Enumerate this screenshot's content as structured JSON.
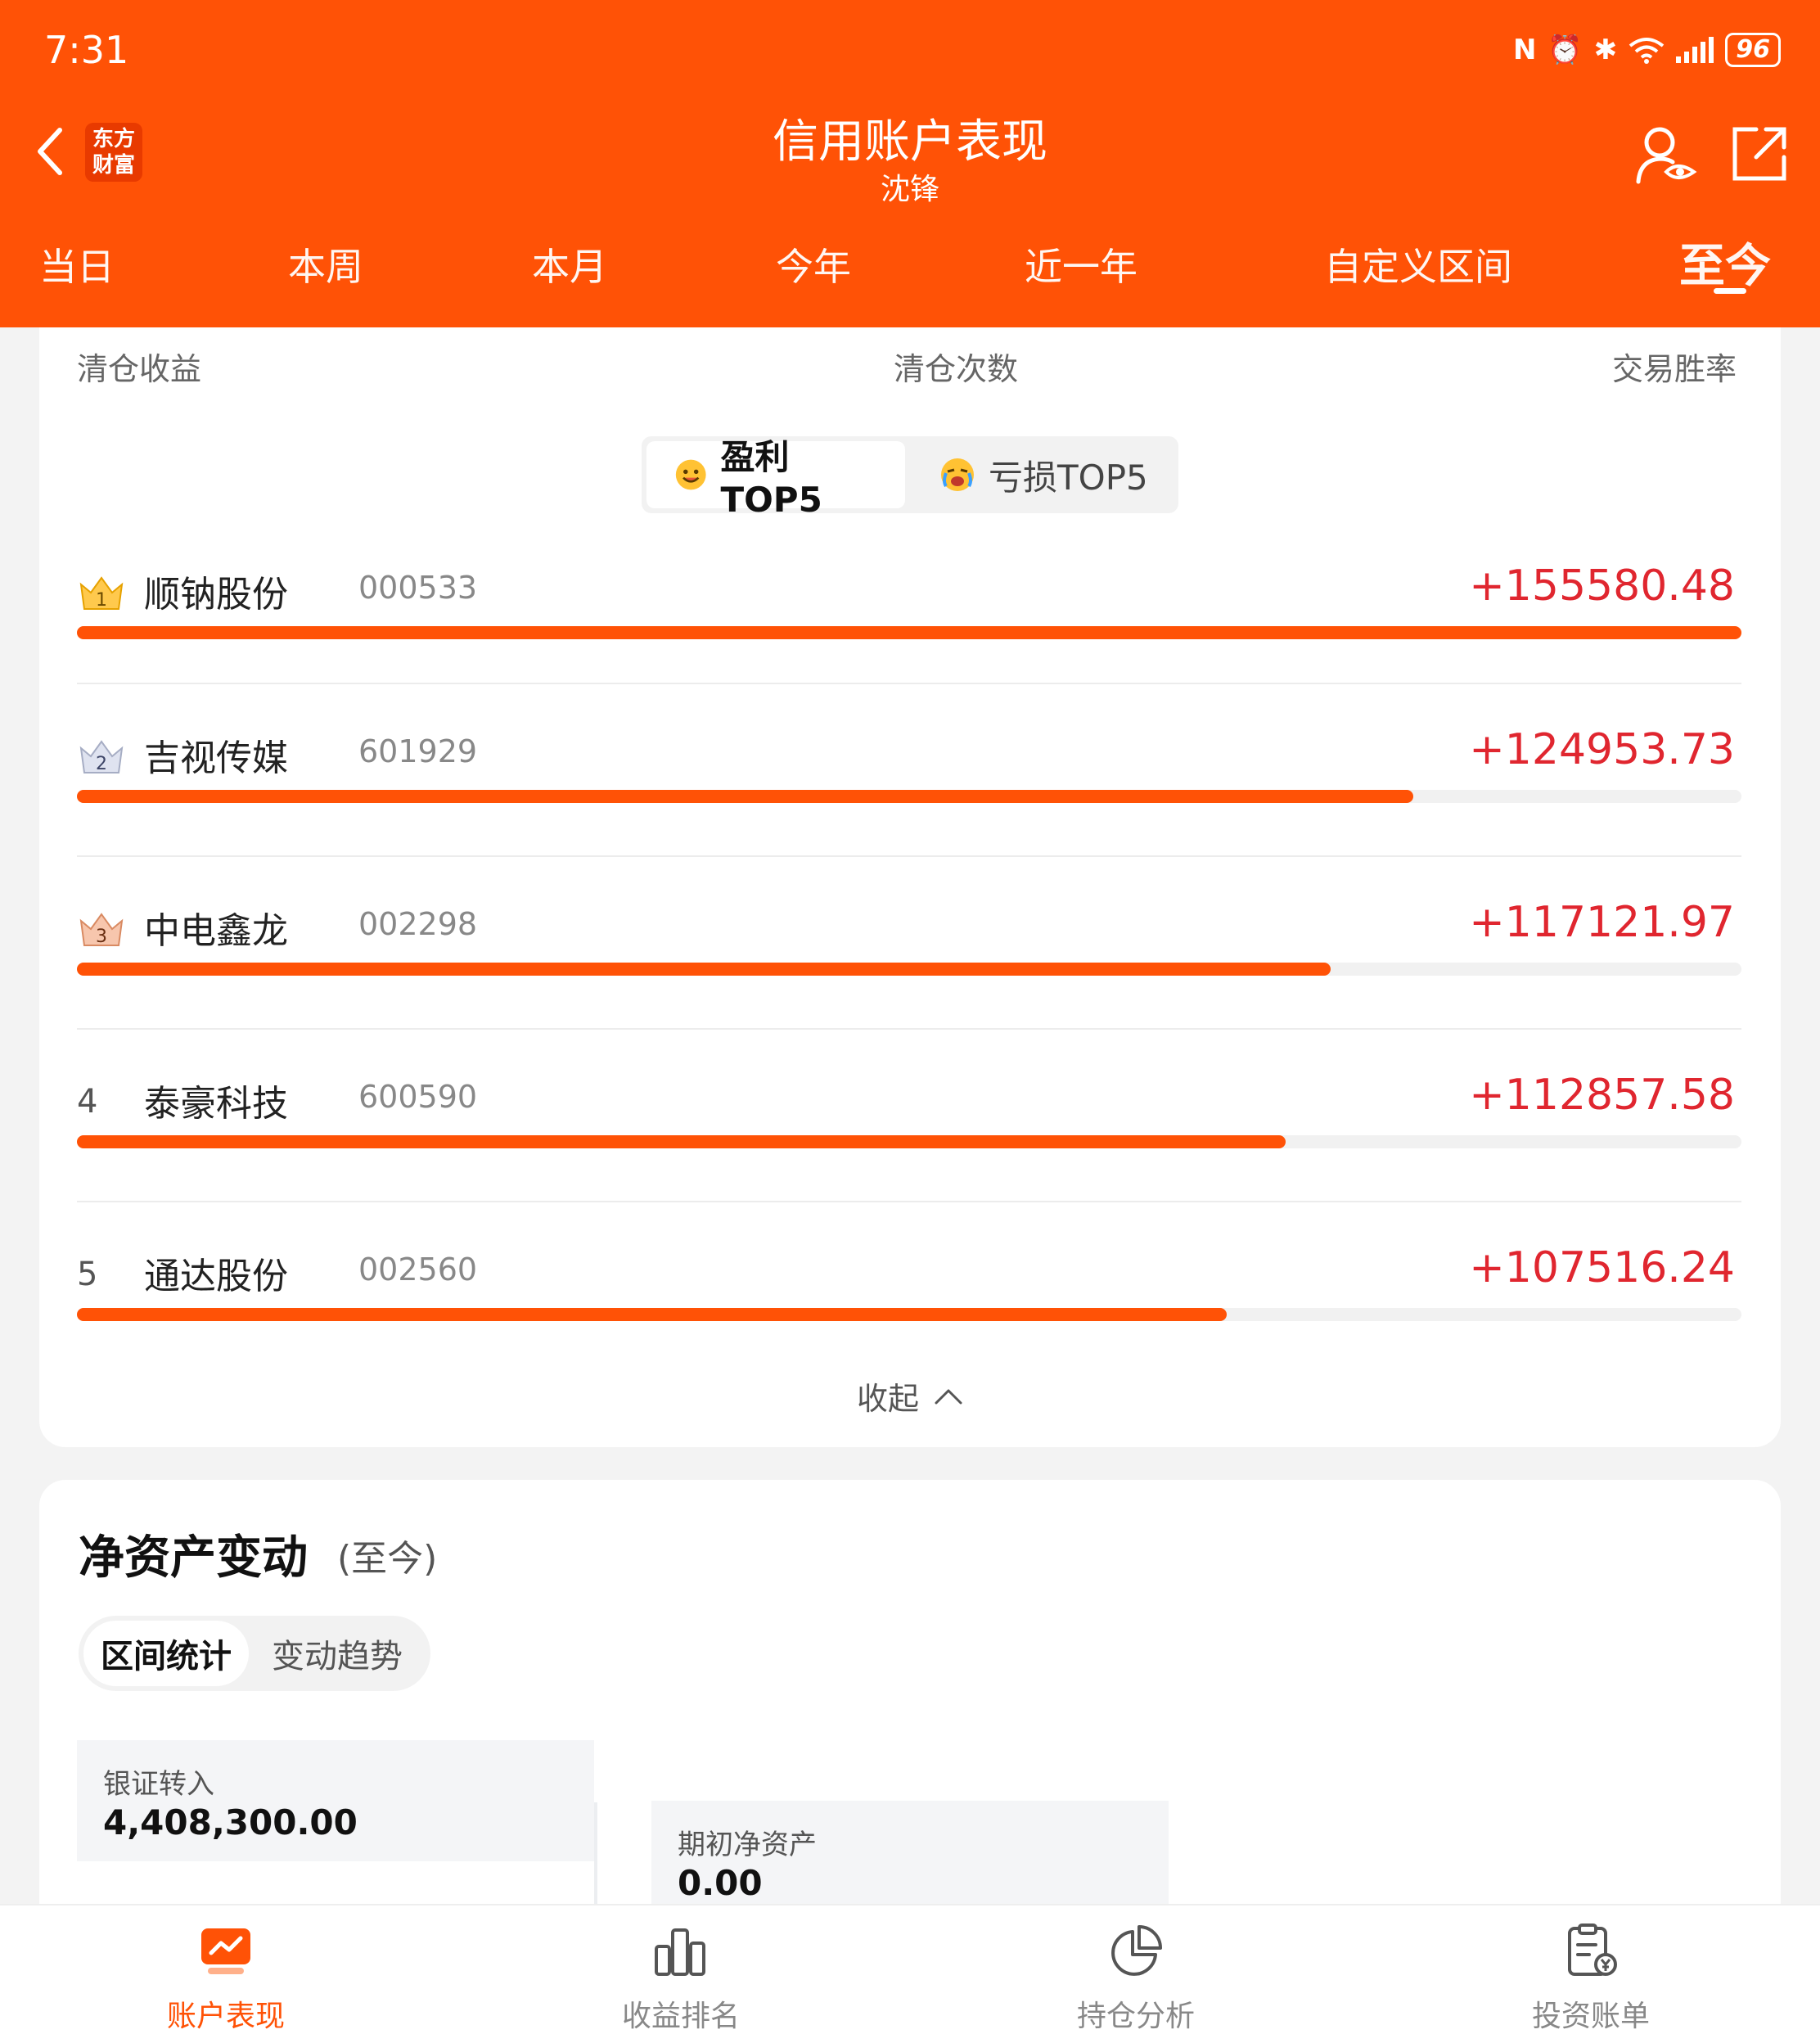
{
  "status": {
    "time": "7:31",
    "battery": "96"
  },
  "header": {
    "logo_text_1": "东方",
    "logo_text_2": "财富",
    "title": "信用账户表现",
    "subtitle": "沈锋"
  },
  "tabs": [
    {
      "label": "当日"
    },
    {
      "label": "本周"
    },
    {
      "label": "本月"
    },
    {
      "label": "今年"
    },
    {
      "label": "近一年"
    },
    {
      "label": "自定义区间"
    },
    {
      "label": "至今"
    }
  ],
  "active_tab_index": 6,
  "stats": {
    "clear_profit_label": "清仓收益",
    "clear_count_label": "清仓次数",
    "win_rate_label": "交易胜率"
  },
  "ranking": {
    "profit_tab": "盈利TOP5",
    "loss_tab": "亏损TOP5",
    "items": [
      {
        "rank": "1",
        "name": "顺钠股份",
        "code": "000533",
        "value": "+155580.48",
        "ratio": 1.0
      },
      {
        "rank": "2",
        "name": "吉视传媒",
        "code": "601929",
        "value": "+124953.73",
        "ratio": 0.803
      },
      {
        "rank": "3",
        "name": "中电鑫龙",
        "code": "002298",
        "value": "+117121.97",
        "ratio": 0.753
      },
      {
        "rank": "4",
        "name": "泰豪科技",
        "code": "600590",
        "value": "+112857.58",
        "ratio": 0.726
      },
      {
        "rank": "5",
        "name": "通达股份",
        "code": "002560",
        "value": "+107516.24",
        "ratio": 0.691
      }
    ],
    "collapse_label": "收起"
  },
  "net_assets": {
    "title": "净资产变动",
    "period": "(至今)",
    "tab_active": "区间统计",
    "tab_inactive": "变动趋势",
    "metrics": [
      {
        "label": "银证转入",
        "value": "4,408,300.00"
      },
      {
        "label": "期初净资产",
        "value": "0.00"
      }
    ]
  },
  "bottom_nav": [
    {
      "label": "账户表现",
      "icon": "account-performance-icon"
    },
    {
      "label": "收益排名",
      "icon": "bar-chart-icon"
    },
    {
      "label": "持仓分析",
      "icon": "pie-chart-icon"
    },
    {
      "label": "投资账单",
      "icon": "bill-icon"
    }
  ],
  "colors": {
    "brand": "#ff5206",
    "positive": "#e0262f"
  }
}
